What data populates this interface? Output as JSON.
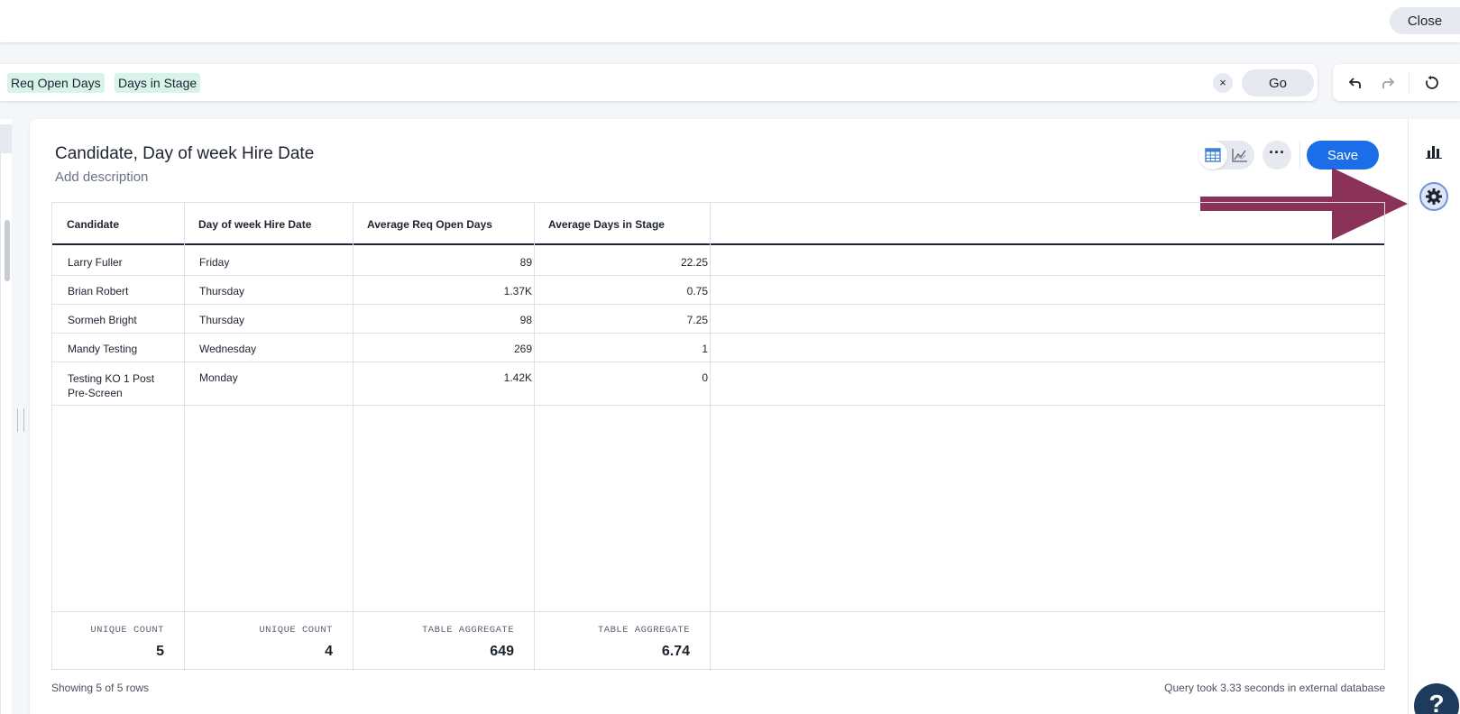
{
  "topbar": {
    "close_label": "Close"
  },
  "search": {
    "tokens": [
      "Req Open Days",
      "Days in Stage"
    ],
    "clear_label": "×",
    "go_label": "Go"
  },
  "answer": {
    "title": "Candidate, Day of week Hire Date",
    "description": "Add description",
    "save_label": "Save",
    "more_label": "···"
  },
  "table": {
    "columns": [
      "Candidate",
      "Day of week Hire Date",
      "Average Req Open Days",
      "Average Days in Stage"
    ],
    "rows": [
      [
        "Larry Fuller",
        "Friday",
        "89",
        "22.25"
      ],
      [
        "Brian Robert",
        "Thursday",
        "1.37K",
        "0.75"
      ],
      [
        "Sormeh Bright",
        "Thursday",
        "98",
        "7.25"
      ],
      [
        "Mandy Testing",
        "Wednesday",
        "269",
        "1"
      ],
      [
        "Testing KO 1 Post Pre-Screen",
        "Monday",
        "1.42K",
        "0"
      ]
    ],
    "aggregates": [
      {
        "label": "UNIQUE COUNT",
        "value": "5"
      },
      {
        "label": "UNIQUE COUNT",
        "value": "4"
      },
      {
        "label": "TABLE AGGREGATE",
        "value": "649"
      },
      {
        "label": "TABLE AGGREGATE",
        "value": "6.74"
      }
    ]
  },
  "status": {
    "rows_text": "Showing 5 of 5 rows",
    "query_text": "Query took 3.33 seconds in external database"
  },
  "help": {
    "label": "?"
  },
  "colors": {
    "accent": "#1b6ee8",
    "token_bg": "#d8f3ea",
    "annotation_arrow": "#8a3258"
  },
  "icons": [
    "undo-icon",
    "redo-icon",
    "reset-icon",
    "table-view-icon",
    "chart-view-icon",
    "bar-chart-icon",
    "gear-icon"
  ]
}
